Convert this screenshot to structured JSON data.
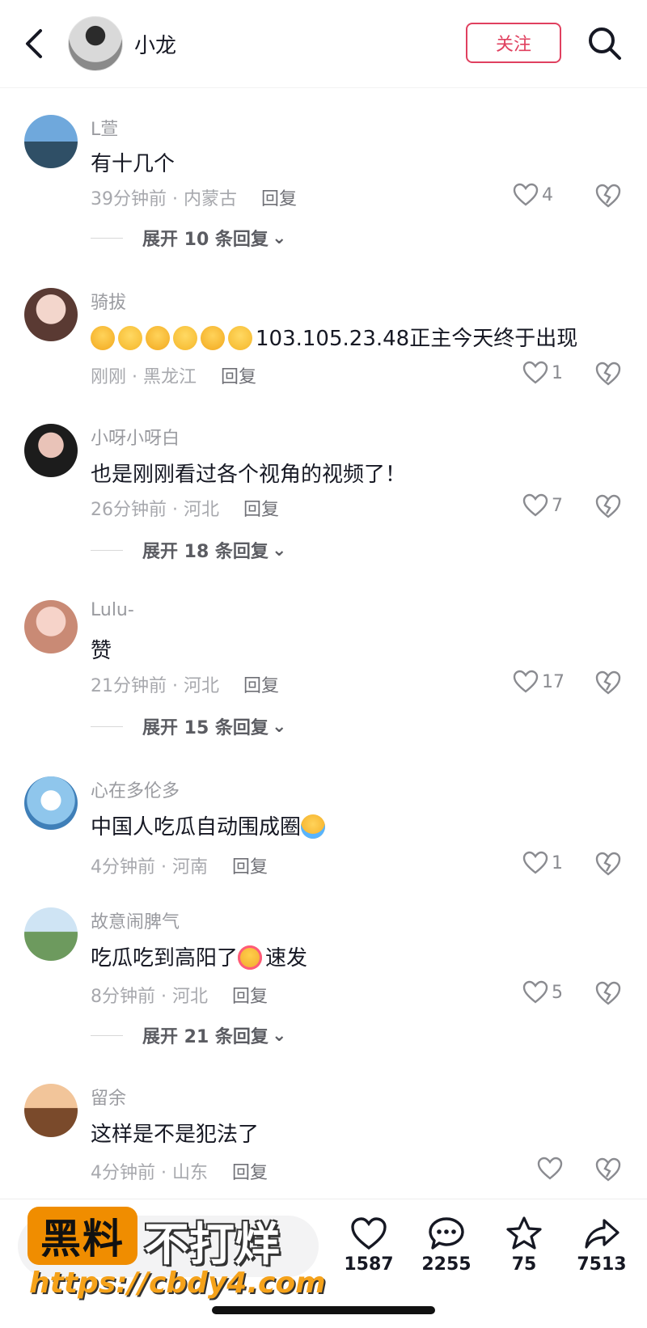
{
  "header": {
    "title": "小龙",
    "follow_label": "关注"
  },
  "comments": [
    {
      "user": "L萱",
      "text": "有十几个",
      "time": "39分钟前 · 内蒙古",
      "reply": "回复",
      "likes": "4",
      "expand": "展开 10 条回复"
    },
    {
      "user": "骑拔",
      "emojis": [
        "emoji-blush",
        "emoji-smile",
        "emoji-pleading",
        "emoji-tearful",
        "emoji-laugh",
        "emoji-pleading"
      ],
      "text": "103.105.23.48正主今天终于出现",
      "time": "刚刚 · 黑龙江",
      "reply": "回复",
      "likes": "1"
    },
    {
      "user": "小呀小呀白",
      "text": "也是刚刚看过各个视角的视频了！",
      "time": "26分钟前 · 河北",
      "reply": "回复",
      "likes": "7",
      "expand": "展开 18 条回复"
    },
    {
      "user": "Lulu-",
      "text": "赞",
      "time": "21分钟前 · 河北",
      "reply": "回复",
      "likes": "17",
      "expand": "展开 15 条回复"
    },
    {
      "user": "心在多伦多",
      "text": "中国人吃瓜自动围成圈",
      "text_emoji": "emoji-crying-laughing",
      "time": "4分钟前 · 河南",
      "reply": "回复",
      "likes": "1"
    },
    {
      "user": "故意闹脾气",
      "text_a": "吃瓜吃到高阳了",
      "text_emoji": "emoji-heart-eyes",
      "text_b": "速发",
      "time": "8分钟前 · 河北",
      "reply": "回复",
      "likes": "5",
      "expand": "展开 21 条回复"
    },
    {
      "user": "留余",
      "text": "这样是不是犯法了",
      "time": "4分钟前 · 山东",
      "reply": "回复",
      "likes": ""
    }
  ],
  "bottom_bar": {
    "like_count": "1587",
    "comment_count": "2255",
    "favorite_count": "75",
    "share_count": "7513"
  },
  "watermark": {
    "box": "黑料",
    "text": "不打烊",
    "url": "https://cbdy4.com"
  },
  "colors": {
    "accent": "#e0405f",
    "watermark_orange": "#f08d00"
  }
}
